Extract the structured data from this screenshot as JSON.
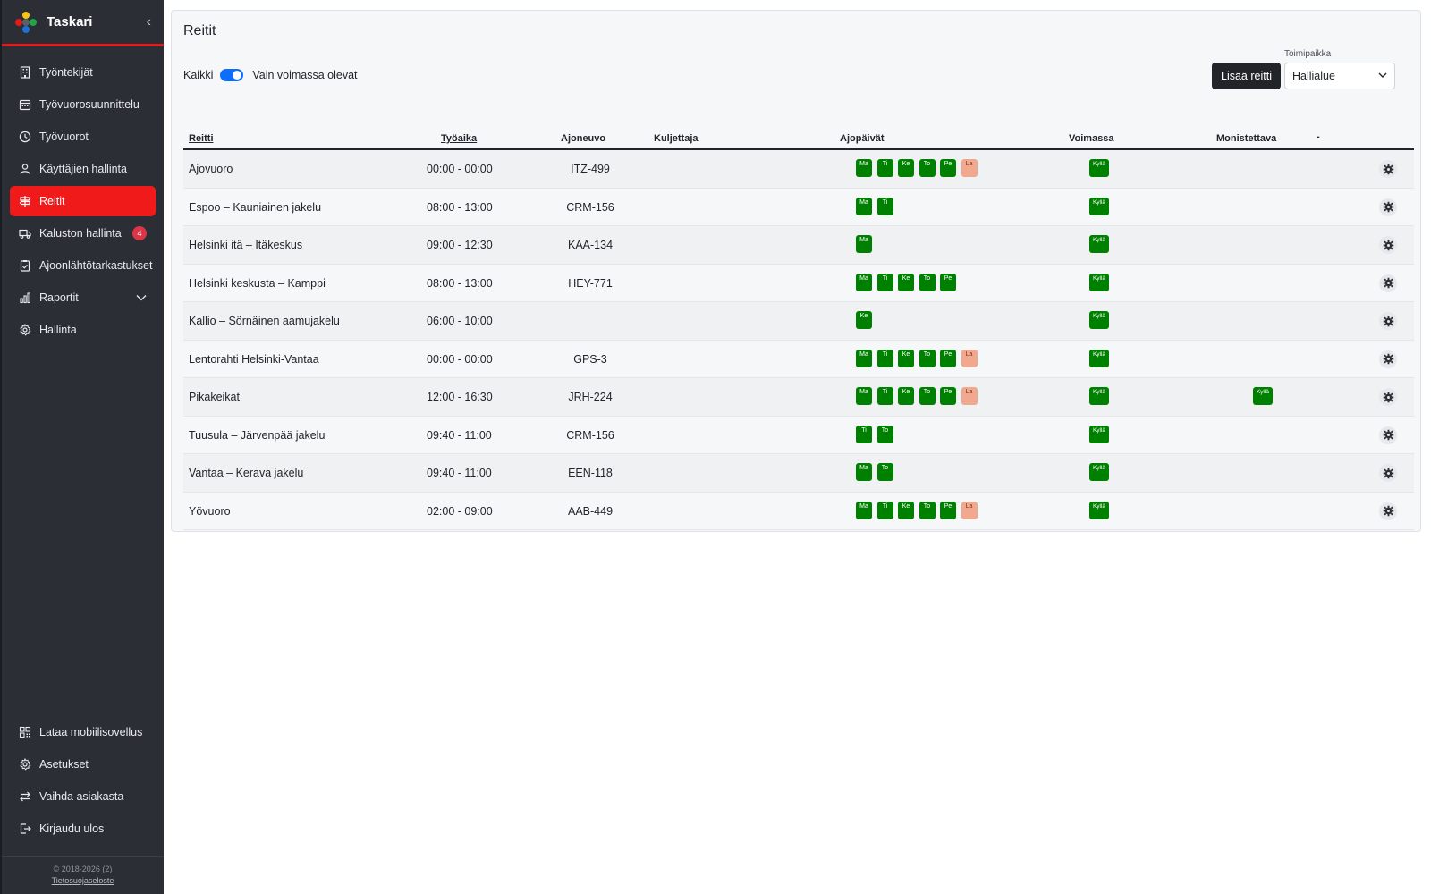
{
  "app": {
    "title": "Taskari"
  },
  "sidebar": {
    "items": [
      {
        "label": "Työntekijät",
        "icon": "building-icon",
        "name": "sidebar-item-tyontekijat"
      },
      {
        "label": "Työvuorosuunnittelu",
        "icon": "calendar-icon",
        "name": "sidebar-item-tyovuorosuunnittelu"
      },
      {
        "label": "Työvuorot",
        "icon": "clock-icon",
        "name": "sidebar-item-tyovuorot"
      },
      {
        "label": "Käyttäjien hallinta",
        "icon": "user-icon",
        "name": "sidebar-item-kayttajien-hallinta"
      },
      {
        "label": "Reitit",
        "icon": "signpost-icon",
        "name": "sidebar-item-reitit",
        "active": true
      },
      {
        "label": "Kaluston hallinta",
        "icon": "truck-icon",
        "name": "sidebar-item-kaluston-hallinta",
        "badge": "4"
      },
      {
        "label": "Ajoonlähtötarkastukset",
        "icon": "clipboard-check-icon",
        "name": "sidebar-item-ajoonlahtotarkastukset"
      },
      {
        "label": "Raportit",
        "icon": "bar-chart-icon",
        "name": "sidebar-item-raportit",
        "expandable": true
      },
      {
        "label": "Hallinta",
        "icon": "gear-icon",
        "name": "sidebar-item-hallinta"
      }
    ],
    "bottom_items": [
      {
        "label": "Lataa mobiilisovellus",
        "icon": "qr-code-icon",
        "name": "sidebar-item-lataa-mobiilisovellus"
      },
      {
        "label": "Asetukset",
        "icon": "gear-icon",
        "name": "sidebar-item-asetukset"
      },
      {
        "label": "Vaihda asiakasta",
        "icon": "swap-icon",
        "name": "sidebar-item-vaihda-asiakasta"
      },
      {
        "label": "Kirjaudu ulos",
        "icon": "logout-icon",
        "name": "sidebar-item-kirjaudu-ulos"
      }
    ],
    "footer": {
      "copyright": "© 2018-2026 (2)",
      "privacy_link": "Tietosuojaseloste"
    }
  },
  "page": {
    "title": "Reitit",
    "filter": {
      "left_label": "Kaikki",
      "right_label": "Vain voimassa olevat",
      "toggle_on": true
    },
    "add_button": "Lisää reitti",
    "location": {
      "label": "Toimipaikka",
      "value": "Hallialue"
    }
  },
  "table": {
    "headers": {
      "route": "Reitti",
      "time": "Työaika",
      "vehicle": "Ajoneuvo",
      "driver": "Kuljettaja",
      "days": "Ajopäivät",
      "valid": "Voimassa",
      "duplicable": "Monistettava",
      "actions": "-"
    },
    "rows": [
      {
        "route": "Ajovuoro",
        "time": "00:00 - 00:00",
        "vehicle": "ITZ-499",
        "driver": "",
        "days": [
          "Ma",
          "Ti",
          "Ke",
          "To",
          "Pe",
          "La"
        ],
        "valid": "Kyllä",
        "duplicable": ""
      },
      {
        "route": "Espoo – Kauniainen jakelu",
        "time": "08:00 - 13:00",
        "vehicle": "CRM-156",
        "driver": "",
        "days": [
          "Ma",
          "Ti"
        ],
        "valid": "Kyllä",
        "duplicable": ""
      },
      {
        "route": "Helsinki itä – Itäkeskus",
        "time": "09:00 - 12:30",
        "vehicle": "KAA-134",
        "driver": "",
        "days": [
          "Ma"
        ],
        "valid": "Kyllä",
        "duplicable": ""
      },
      {
        "route": "Helsinki keskusta – Kamppi",
        "time": "08:00 - 13:00",
        "vehicle": "HEY-771",
        "driver": "",
        "days": [
          "Ma",
          "Ti",
          "Ke",
          "To",
          "Pe"
        ],
        "valid": "Kyllä",
        "duplicable": ""
      },
      {
        "route": "Kallio – Sörnäinen aamujakelu",
        "time": "06:00 - 10:00",
        "vehicle": "",
        "driver": "",
        "days": [
          "Ke"
        ],
        "valid": "Kyllä",
        "duplicable": ""
      },
      {
        "route": "Lentorahti Helsinki-Vantaa",
        "time": "00:00 - 00:00",
        "vehicle": "GPS-3",
        "driver": "",
        "days": [
          "Ma",
          "Ti",
          "Ke",
          "To",
          "Pe",
          "La"
        ],
        "valid": "Kyllä",
        "duplicable": ""
      },
      {
        "route": "Pikakeikat",
        "time": "12:00 - 16:30",
        "vehicle": "JRH-224",
        "driver": "",
        "days": [
          "Ma",
          "Ti",
          "Ke",
          "To",
          "Pe",
          "La"
        ],
        "valid": "Kyllä",
        "duplicable": "Kyllä"
      },
      {
        "route": "Tuusula – Järvenpää jakelu",
        "time": "09:40 - 11:00",
        "vehicle": "CRM-156",
        "driver": "",
        "days": [
          "Ti",
          "To"
        ],
        "valid": "Kyllä",
        "duplicable": ""
      },
      {
        "route": "Vantaa – Kerava jakelu",
        "time": "09:40 - 11:00",
        "vehicle": "EEN-118",
        "driver": "",
        "days": [
          "Ma",
          "To"
        ],
        "valid": "Kyllä",
        "duplicable": ""
      },
      {
        "route": "Yövuoro",
        "time": "02:00 - 09:00",
        "vehicle": "AAB-449",
        "driver": "",
        "days": [
          "Ma",
          "Ti",
          "Ke",
          "To",
          "Pe",
          "La"
        ],
        "valid": "Kyllä",
        "duplicable": ""
      }
    ]
  },
  "colors": {
    "accent": "#f01a1a",
    "sidebar_bg": "#2b2f35",
    "day_green": "#008000",
    "day_saturday": "#f0a98f",
    "primary_toggle": "#0d6efd"
  }
}
